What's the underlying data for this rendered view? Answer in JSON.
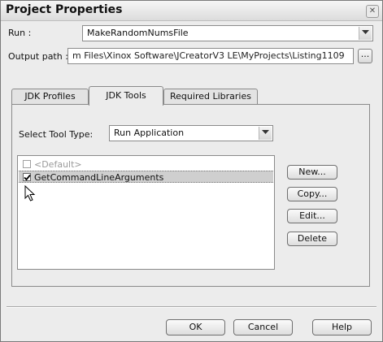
{
  "window": {
    "title": "Project Properties"
  },
  "run": {
    "label": "Run :",
    "value": "MakeRandomNumsFile"
  },
  "output_path": {
    "label": "Output path :",
    "value": "m Files\\Xinox Software\\JCreatorV3 LE\\MyProjects\\Listing1109",
    "browse_label": "..."
  },
  "tabs": [
    {
      "label": "JDK Profiles",
      "active": false
    },
    {
      "label": "JDK Tools",
      "active": true
    },
    {
      "label": "Required Libraries",
      "active": false
    }
  ],
  "tool_type": {
    "label": "Select Tool Type:",
    "value": "Run Application"
  },
  "tools_list": [
    {
      "label": "<Default>",
      "checked": false,
      "disabled": true
    },
    {
      "label": "GetCommandLineArguments",
      "checked": true,
      "selected": true
    }
  ],
  "side_buttons": {
    "new": "New...",
    "copy": "Copy...",
    "edit": "Edit...",
    "delete": "Delete"
  },
  "footer_buttons": {
    "ok": "OK",
    "cancel": "Cancel",
    "help": "Help"
  }
}
